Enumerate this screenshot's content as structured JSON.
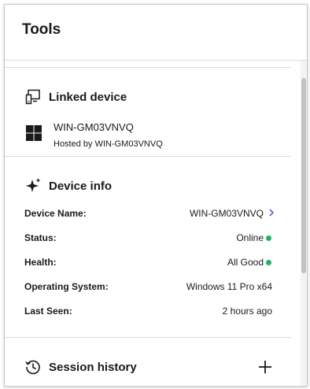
{
  "header": {
    "title": "Tools"
  },
  "linked_device": {
    "title": "Linked device",
    "device_name": "WIN-GM03VNVQ",
    "hosted_by": "Hosted by WIN-GM03VNVQ"
  },
  "device_info": {
    "title": "Device info",
    "rows": [
      {
        "label": "Device Name:",
        "value": "WIN-GM03VNVQ"
      },
      {
        "label": "Status:",
        "value": "Online"
      },
      {
        "label": "Health:",
        "value": "All Good"
      },
      {
        "label": "Operating System:",
        "value": "Windows 11 Pro x64"
      },
      {
        "label": "Last Seen:",
        "value": "2 hours ago"
      }
    ]
  },
  "session_history": {
    "title": "Session history"
  },
  "colors": {
    "status_online": "#1db36a",
    "chevron_accent": "#7b4fd6"
  },
  "icons": {
    "linked_device": "linked-device-icon",
    "windows": "windows-logo-icon",
    "device_info": "sparkle-icon",
    "session_history": "history-icon",
    "chevron": "chevron-right-icon",
    "add": "plus-icon"
  }
}
